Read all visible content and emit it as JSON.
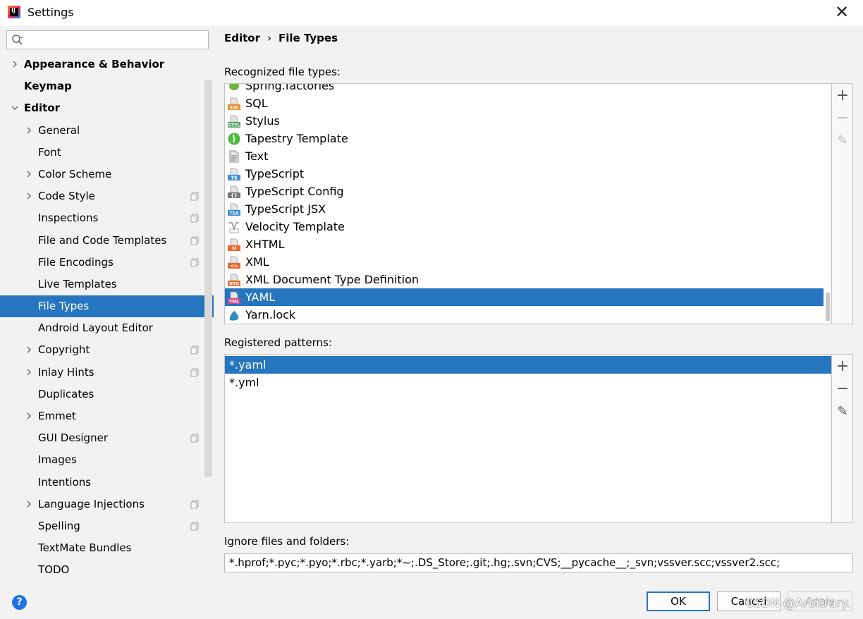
{
  "window": {
    "title": "Settings",
    "app_icon": "intellij-idea-icon",
    "close_glyph": "✕"
  },
  "search": {
    "placeholder": "",
    "value": ""
  },
  "sidebar": {
    "items": [
      {
        "label": "Appearance & Behavior",
        "bold": true,
        "expandable": "collapsed",
        "indent": 0,
        "copy_icon": false
      },
      {
        "label": "Keymap",
        "bold": true,
        "expandable": "none",
        "indent": 0,
        "copy_icon": false
      },
      {
        "label": "Editor",
        "bold": true,
        "expandable": "expanded",
        "indent": 0,
        "copy_icon": false
      },
      {
        "label": "General",
        "bold": false,
        "expandable": "collapsed",
        "indent": 1,
        "copy_icon": false
      },
      {
        "label": "Font",
        "bold": false,
        "expandable": "none",
        "indent": 1,
        "copy_icon": false
      },
      {
        "label": "Color Scheme",
        "bold": false,
        "expandable": "collapsed",
        "indent": 1,
        "copy_icon": false
      },
      {
        "label": "Code Style",
        "bold": false,
        "expandable": "collapsed",
        "indent": 1,
        "copy_icon": true
      },
      {
        "label": "Inspections",
        "bold": false,
        "expandable": "none",
        "indent": 1,
        "copy_icon": true
      },
      {
        "label": "File and Code Templates",
        "bold": false,
        "expandable": "none",
        "indent": 1,
        "copy_icon": true
      },
      {
        "label": "File Encodings",
        "bold": false,
        "expandable": "none",
        "indent": 1,
        "copy_icon": true
      },
      {
        "label": "Live Templates",
        "bold": false,
        "expandable": "none",
        "indent": 1,
        "copy_icon": false
      },
      {
        "label": "File Types",
        "bold": false,
        "expandable": "none",
        "indent": 1,
        "copy_icon": false,
        "selected": true
      },
      {
        "label": "Android Layout Editor",
        "bold": false,
        "expandable": "none",
        "indent": 1,
        "copy_icon": false
      },
      {
        "label": "Copyright",
        "bold": false,
        "expandable": "collapsed",
        "indent": 1,
        "copy_icon": true
      },
      {
        "label": "Inlay Hints",
        "bold": false,
        "expandable": "collapsed",
        "indent": 1,
        "copy_icon": true
      },
      {
        "label": "Duplicates",
        "bold": false,
        "expandable": "none",
        "indent": 1,
        "copy_icon": false
      },
      {
        "label": "Emmet",
        "bold": false,
        "expandable": "collapsed",
        "indent": 1,
        "copy_icon": false
      },
      {
        "label": "GUI Designer",
        "bold": false,
        "expandable": "none",
        "indent": 1,
        "copy_icon": true
      },
      {
        "label": "Images",
        "bold": false,
        "expandable": "none",
        "indent": 1,
        "copy_icon": false
      },
      {
        "label": "Intentions",
        "bold": false,
        "expandable": "none",
        "indent": 1,
        "copy_icon": false
      },
      {
        "label": "Language Injections",
        "bold": false,
        "expandable": "collapsed",
        "indent": 1,
        "copy_icon": true
      },
      {
        "label": "Spelling",
        "bold": false,
        "expandable": "none",
        "indent": 1,
        "copy_icon": true
      },
      {
        "label": "TextMate Bundles",
        "bold": false,
        "expandable": "none",
        "indent": 1,
        "copy_icon": false
      },
      {
        "label": "TODO",
        "bold": false,
        "expandable": "none",
        "indent": 1,
        "copy_icon": false
      }
    ]
  },
  "breadcrumb": {
    "parent": "Editor",
    "separator": "›",
    "current": "File Types"
  },
  "recognized": {
    "label": "Recognized file types:",
    "items": [
      {
        "name": "Spring.factories",
        "icon": "spring-factories-icon",
        "badge": "",
        "color": "#6db33f"
      },
      {
        "name": "SQL",
        "icon": "sql-file-icon",
        "badge": "SQL",
        "color": "#e8912d"
      },
      {
        "name": "Stylus",
        "icon": "stylus-file-icon",
        "badge": "STYL",
        "color": "#59a869"
      },
      {
        "name": "Tapestry Template",
        "icon": "tapestry-icon",
        "badge": "",
        "color": "#4fba3f"
      },
      {
        "name": "Text",
        "icon": "text-file-icon",
        "badge": "",
        "color": "#9a9a9a"
      },
      {
        "name": "TypeScript",
        "icon": "typescript-file-icon",
        "badge": "TS",
        "color": "#3d8fd6"
      },
      {
        "name": "TypeScript Config",
        "icon": "typescript-config-icon",
        "badge": "{}",
        "color": "#777777"
      },
      {
        "name": "TypeScript JSX",
        "icon": "tsx-file-icon",
        "badge": "TSX",
        "color": "#3d8fd6"
      },
      {
        "name": "Velocity Template",
        "icon": "velocity-icon",
        "badge": "",
        "color": "#888888"
      },
      {
        "name": "XHTML",
        "icon": "xhtml-file-icon",
        "badge": "H",
        "color": "#e8692d"
      },
      {
        "name": "XML",
        "icon": "xml-file-icon",
        "badge": "<>",
        "color": "#e8692d"
      },
      {
        "name": "XML Document Type Definition",
        "icon": "dtd-file-icon",
        "badge": "DTD",
        "color": "#e8692d"
      },
      {
        "name": "YAML",
        "icon": "yaml-file-icon",
        "badge": "YML",
        "color": "#c84c8c",
        "selected": true
      },
      {
        "name": "Yarn.lock",
        "icon": "yarn-icon",
        "badge": "",
        "color": "#2c8ebb"
      }
    ]
  },
  "patterns": {
    "label": "Registered patterns:",
    "items": [
      {
        "value": "*.yaml",
        "selected": true
      },
      {
        "value": "*.yml",
        "selected": false
      }
    ]
  },
  "tools": {
    "add": "+",
    "remove": "−",
    "edit": "✎"
  },
  "ignore": {
    "label": "Ignore files and folders:",
    "value": "*.hprof;*.pyc;*.pyo;*.rbc;*.yarb;*~;.DS_Store;.git;.hg;.svn;CVS;__pycache__;_svn;vssver.scc;vssver2.scc;"
  },
  "footer": {
    "help": "?",
    "ok": "OK",
    "cancel": "Cancel",
    "apply": "Apply"
  },
  "watermark": "CSDN @Arbitrary."
}
